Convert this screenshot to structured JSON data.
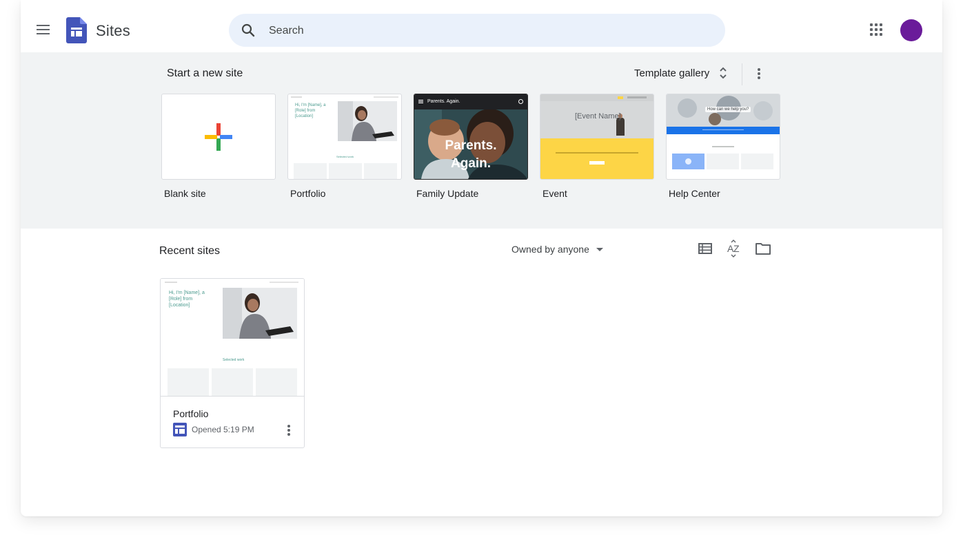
{
  "app": {
    "title": "Sites"
  },
  "search": {
    "placeholder": "Search"
  },
  "templates": {
    "section_title": "Start a new site",
    "gallery_label": "Template gallery",
    "items": [
      {
        "label": "Blank site"
      },
      {
        "label": "Portfolio",
        "thumb_heading": "Hi, I'm [Name], a [Role] from [Location]",
        "thumb_caption": "Selected work"
      },
      {
        "label": "Family Update",
        "thumb_header": "Parents. Again.",
        "thumb_overlay": "Parents. Again."
      },
      {
        "label": "Event",
        "thumb_heading": "[Event Name]"
      },
      {
        "label": "Help Center",
        "thumb_heading": "How can we help you?"
      }
    ]
  },
  "recent": {
    "section_title": "Recent sites",
    "owner_filter": "Owned by anyone",
    "sites": [
      {
        "name": "Portfolio",
        "meta": "Opened 5:19 PM",
        "thumb_heading": "Hi, I'm [Name], a [Role] from [Location]",
        "thumb_caption": "Selected work"
      }
    ]
  },
  "colors": {
    "accent": "#4355b9",
    "band": "#f1f3f4",
    "avatar": "#6a1b9a",
    "event_yellow": "#fdd546",
    "help_blue": "#1a73e8"
  },
  "icons": [
    "menu-icon",
    "sites-logo-icon",
    "search-icon",
    "apps-grid-icon",
    "unfold-icon",
    "more-vert-icon",
    "plus-icon",
    "list-view-icon",
    "sort-az-icon",
    "folder-icon",
    "site-file-icon"
  ]
}
